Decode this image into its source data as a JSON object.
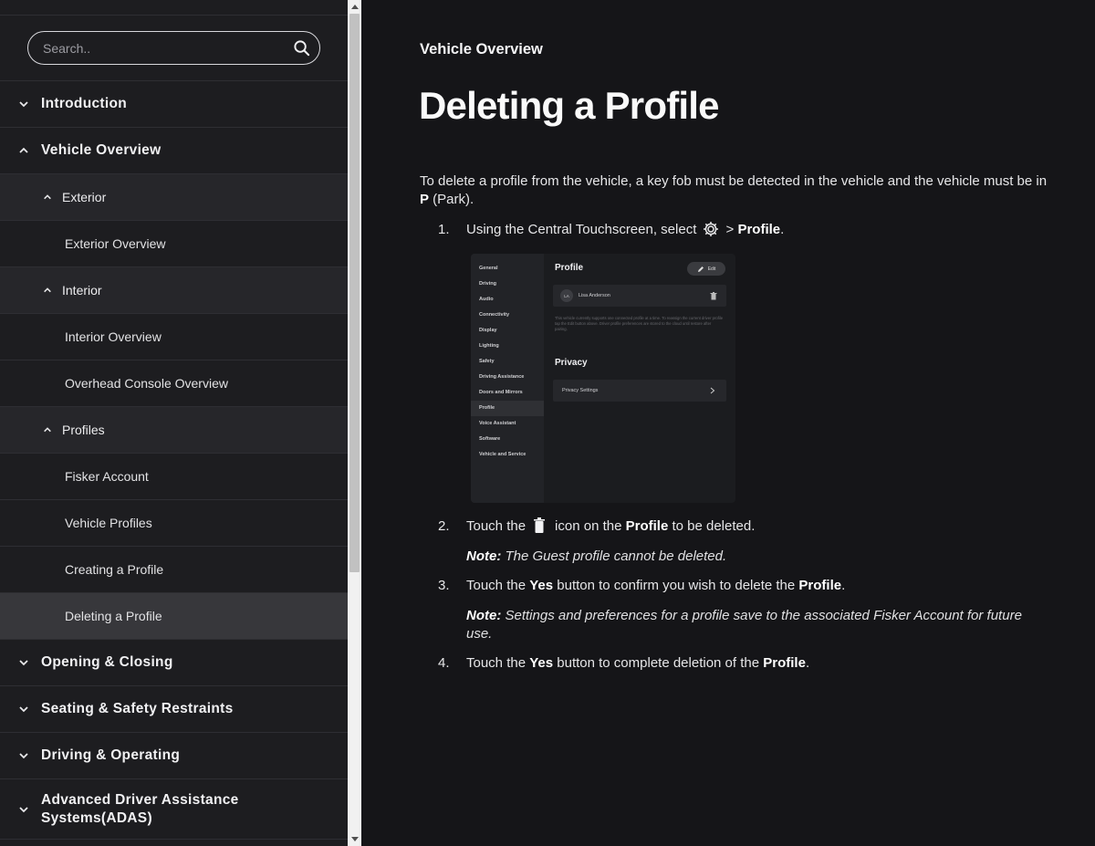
{
  "search": {
    "placeholder": "Search.."
  },
  "sidebar": {
    "introduction": "Introduction",
    "vehicle_overview": "Vehicle Overview",
    "exterior": "Exterior",
    "exterior_overview": "Exterior Overview",
    "interior": "Interior",
    "interior_overview": "Interior Overview",
    "overhead_console_overview": "Overhead Console Overview",
    "profiles": "Profiles",
    "fisker_account": "Fisker Account",
    "vehicle_profiles": "Vehicle Profiles",
    "creating_a_profile": "Creating a Profile",
    "deleting_a_profile": "Deleting a Profile",
    "opening_closing": "Opening & Closing",
    "seating_safety": "Seating & Safety Restraints",
    "driving_operating": "Driving & Operating",
    "adas": "Advanced Driver Assistance Systems(ADAS)"
  },
  "content": {
    "breadcrumb": "Vehicle Overview",
    "title": "Deleting a Profile",
    "intro_text": "To delete a profile from the vehicle, a key fob must be detected in the vehicle and the vehicle must be in ",
    "intro_bold": "P",
    "intro_tail": " (Park).",
    "step1_num": "1.",
    "step1_text": "Using the Central Touchscreen, select",
    "step1_sep": " > ",
    "step1_bold": "Profile",
    "step1_end": ".",
    "step2_num": "2.",
    "step2_a": "Touch the",
    "step2_b": "icon on the ",
    "step2_bold": "Profile",
    "step2_c": " to be deleted.",
    "note1_label": "Note:",
    "note1_text": " The Guest profile cannot be deleted.",
    "step3_num": "3.",
    "step3_a": "Touch the ",
    "step3_bold1": "Yes",
    "step3_b": " button to confirm you wish to delete the ",
    "step3_bold2": "Profile",
    "step3_c": ".",
    "note2_label": "Note:",
    "note2_text": " Settings and preferences for a profile save to the associated Fisker Account for future use.",
    "step4_num": "4.",
    "step4_a": "Touch the ",
    "step4_bold1": "Yes",
    "step4_b": " button to complete deletion of the ",
    "step4_bold2": "Profile",
    "step4_c": "."
  },
  "screenshot": {
    "menu": [
      "General",
      "Driving",
      "Audio",
      "Connectivity",
      "Display",
      "Lighting",
      "Safety",
      "Driving Assistance",
      "Doors and Mirrors",
      "Profile",
      "Voice Assistant",
      "Software",
      "Vehicle and Service"
    ],
    "profile_heading": "Profile",
    "edit_label": "Edit",
    "avatar_initials": "LA",
    "profile_name": "Lisa Anderson",
    "description": "This vehicle currently supports one connected profile at a time. To reassign the current driver profile tap the Edit button above. Driver profile preferences are stored to the cloud until restore after pairing.",
    "privacy_heading": "Privacy",
    "privacy_settings": "Privacy Settings"
  }
}
